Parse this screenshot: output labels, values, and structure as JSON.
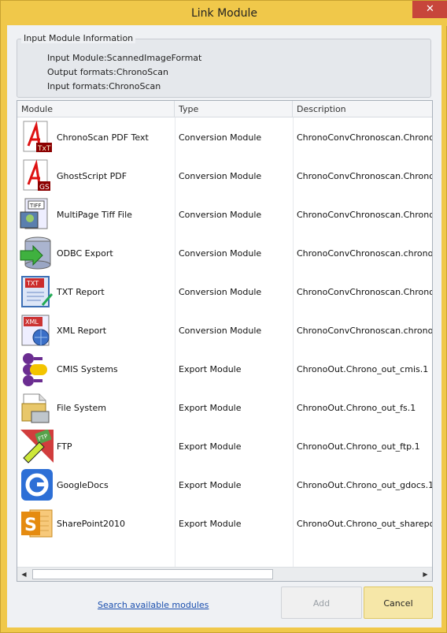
{
  "window": {
    "title": "Link Module",
    "close_glyph": "✕"
  },
  "info": {
    "legend": "Input Module Information",
    "lines": [
      "Input Module:ScannedImageFormat",
      "Output formats:ChronoScan",
      "Input formats:ChronoScan"
    ]
  },
  "list": {
    "columns": [
      "Module",
      "Type",
      "Description"
    ],
    "rows": [
      {
        "module": "ChronoScan PDF Text",
        "type": "Conversion Module",
        "description": "ChronoConvChronoscan.ChronoCon",
        "icon": "pdf-text-icon"
      },
      {
        "module": "GhostScript PDF",
        "type": "Conversion Module",
        "description": "ChronoConvChronoscan.Chrono_co",
        "icon": "ghostscript-pdf-icon"
      },
      {
        "module": "MultiPage Tiff File",
        "type": "Conversion Module",
        "description": "ChronoConvChronoscan.ChronoCon",
        "icon": "tiff-file-icon"
      },
      {
        "module": "ODBC Export",
        "type": "Conversion Module",
        "description": "ChronoConvChronoscan.chrono_co",
        "icon": "database-icon"
      },
      {
        "module": "TXT Report",
        "type": "Conversion Module",
        "description": "ChronoConvChronoscan.Chrono_co",
        "icon": "txt-report-icon"
      },
      {
        "module": "XML Report",
        "type": "Conversion Module",
        "description": "ChronoConvChronoscan.chrono_co",
        "icon": "xml-report-icon"
      },
      {
        "module": "CMIS Systems",
        "type": "Export Module",
        "description": "ChronoOut.Chrono_out_cmis.1",
        "icon": "cmis-icon"
      },
      {
        "module": "File System",
        "type": "Export Module",
        "description": "ChronoOut.Chrono_out_fs.1",
        "icon": "file-system-icon"
      },
      {
        "module": "FTP",
        "type": "Export Module",
        "description": "ChronoOut.Chrono_out_ftp.1",
        "icon": "ftp-icon"
      },
      {
        "module": "GoogleDocs",
        "type": "Export Module",
        "description": "ChronoOut.Chrono_out_gdocs.1",
        "icon": "google-docs-icon"
      },
      {
        "module": "SharePoint2010",
        "type": "Export Module",
        "description": "ChronoOut.Chrono_out_sharepoint",
        "icon": "sharepoint-icon"
      }
    ]
  },
  "scroll": {
    "left_glyph": "◀",
    "right_glyph": "▶"
  },
  "footer": {
    "link_label": "Search available modules",
    "add_label": "Add",
    "cancel_label": "Cancel"
  }
}
